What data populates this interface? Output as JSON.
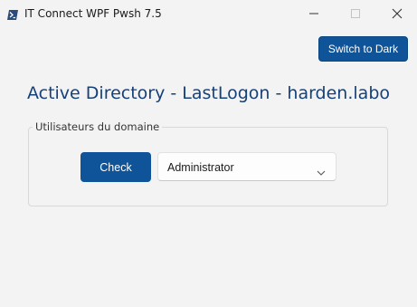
{
  "window": {
    "title": "IT Connect WPF Pwsh 7.5"
  },
  "toolbar": {
    "theme_button_label": "Switch to Dark"
  },
  "main": {
    "title": "Active Directory - LastLogon - harden.labo",
    "group": {
      "label": "Utilisateurs du domaine",
      "check_label": "Check",
      "user_select": {
        "selected": "Administrator"
      }
    }
  },
  "colors": {
    "accent": "#0f5499",
    "title_text": "#15417a",
    "background": "#f3f3f3"
  },
  "icons": {
    "app": "powershell-icon",
    "minimize": "minimize-icon",
    "maximize": "maximize-icon",
    "close": "close-icon",
    "dropdown": "chevron-down-icon"
  }
}
